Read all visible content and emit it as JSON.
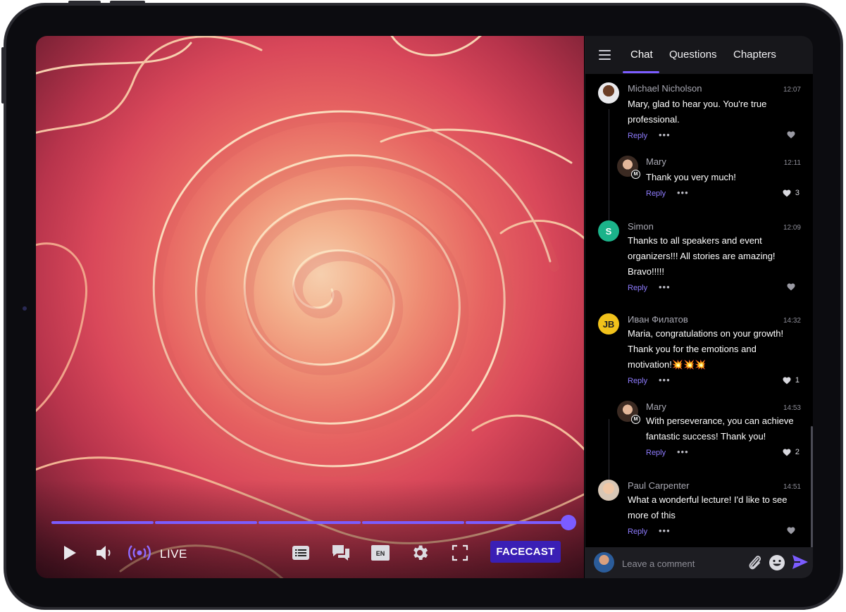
{
  "player": {
    "live_label": "LIVE",
    "brand_label": "FACECAST",
    "lang_code": "EN",
    "progress_percent": 100,
    "progress_segments": 5,
    "accent_color": "#7b5cff"
  },
  "chat_panel": {
    "tabs": [
      {
        "label": "Chat",
        "active": true
      },
      {
        "label": "Questions",
        "active": false
      },
      {
        "label": "Chapters",
        "active": false
      }
    ],
    "messages": [
      {
        "name": "Michael Nicholson",
        "time": "12:07",
        "lines": [
          "Mary, glad to hear you. You're true",
          "professional."
        ],
        "reply": "Reply",
        "likes": ""
      },
      {
        "name": "Mary",
        "time": "12:11",
        "lines": [
          "Thank you very much!"
        ],
        "reply": "Reply",
        "likes": "3",
        "badge": "M"
      },
      {
        "name": "Simon",
        "time": "12:09",
        "initial": "S",
        "lines": [
          "Thanks to all speakers and event",
          "organizers!!! All stories are amazing!",
          "Bravo!!!!!"
        ],
        "reply": "Reply",
        "likes": ""
      },
      {
        "name": "Иван Филатов",
        "time": "14:32",
        "initial": "JB",
        "lines": [
          "Maria, congratulations on your growth!",
          "Thank you for the emotions and",
          "motivation!💥💥💥"
        ],
        "reply": "Reply",
        "likes": "1"
      },
      {
        "name": "Mary",
        "time": "14:53",
        "lines": [
          "With perseverance, you can achieve",
          "fantastic success! Thank you!"
        ],
        "reply": "Reply",
        "likes": "2",
        "badge": "M"
      },
      {
        "name": "Paul Carpenter",
        "time": "14:51",
        "lines": [
          "What a wonderful lecture!  I'd like to see",
          "more of this"
        ],
        "reply": "Reply",
        "likes": ""
      }
    ],
    "composer": {
      "placeholder": "Leave a comment"
    }
  }
}
